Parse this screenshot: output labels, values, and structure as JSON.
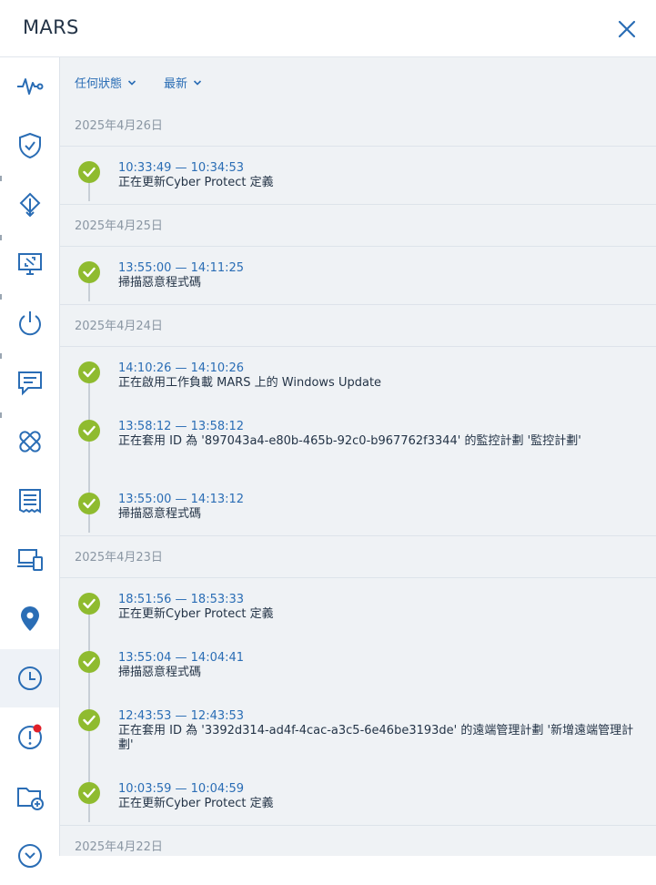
{
  "header": {
    "title": "MARS"
  },
  "filters": {
    "status": "任何狀態",
    "sort": "最新"
  },
  "sidebar": {
    "items": [
      {
        "name": "activity-pulse-icon"
      },
      {
        "name": "shield-check-icon"
      },
      {
        "name": "network-share-icon"
      },
      {
        "name": "remote-desktop-icon"
      },
      {
        "name": "power-icon"
      },
      {
        "name": "chat-icon"
      },
      {
        "name": "patch-icon"
      },
      {
        "name": "inventory-list-icon"
      },
      {
        "name": "devices-icon"
      },
      {
        "name": "location-pin-icon"
      },
      {
        "name": "history-clock-icon"
      },
      {
        "name": "alert-icon"
      },
      {
        "name": "folder-add-icon"
      },
      {
        "name": "more-circle-icon"
      }
    ],
    "active_index": 10
  },
  "colors": {
    "accent": "#2a6db5",
    "success": "#8fbb2f",
    "alert_dot": "#e0202a"
  },
  "groups": [
    {
      "date": "2025年4月26日",
      "entries": [
        {
          "time": "10:33:49 — 10:34:53",
          "desc": "正在更新Cyber Protect 定義"
        }
      ]
    },
    {
      "date": "2025年4月25日",
      "entries": [
        {
          "time": "13:55:00 — 14:11:25",
          "desc": "掃描惡意程式碼"
        }
      ]
    },
    {
      "date": "2025年4月24日",
      "entries": [
        {
          "time": "14:10:26 — 14:10:26",
          "desc": "正在啟用工作負載 MARS 上的 Windows Update"
        },
        {
          "time": "13:58:12 — 13:58:12",
          "desc": "正在套用 ID 為 '897043a4-e80b-465b-92c0-b967762f3344' 的監控計劃 '監控計劃'"
        },
        {
          "time": "13:55:00 — 14:13:12",
          "desc": "掃描惡意程式碼"
        }
      ]
    },
    {
      "date": "2025年4月23日",
      "entries": [
        {
          "time": "18:51:56 — 18:53:33",
          "desc": "正在更新Cyber Protect 定義"
        },
        {
          "time": "13:55:04 — 14:04:41",
          "desc": "掃描惡意程式碼"
        },
        {
          "time": "12:43:53 — 12:43:53",
          "desc": "正在套用 ID 為 '3392d314-ad4f-4cac-a3c5-6e46be3193de' 的遠端管理計劃 '新增遠端管理計劃'"
        },
        {
          "time": "10:03:59 — 10:04:59",
          "desc": "正在更新Cyber Protect 定義"
        }
      ]
    },
    {
      "date": "2025年4月22日",
      "entries": []
    }
  ]
}
